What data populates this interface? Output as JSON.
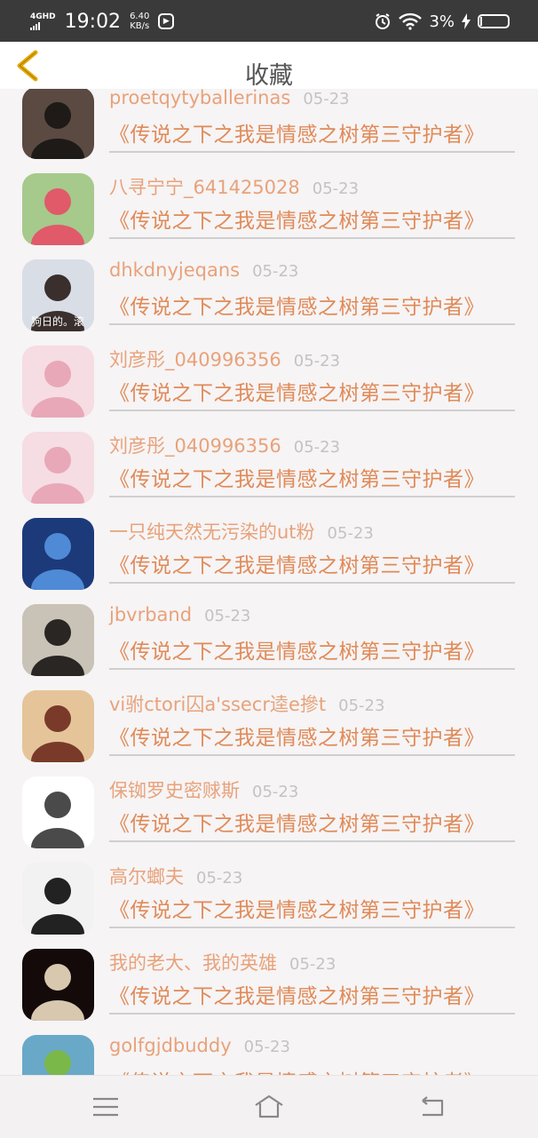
{
  "status": {
    "network": "4GHD",
    "time": "19:02",
    "speed_value": "6.40",
    "speed_unit": "KB/s",
    "battery": "3%"
  },
  "header": {
    "title": "收藏"
  },
  "colors": {
    "accent": "#e08a58",
    "name": "#e8a27a",
    "date": "#c3c3c3",
    "back": "#e6a800"
  },
  "items": [
    {
      "name": "proetqytyballerinas",
      "date": "05-23",
      "book": "《传说之下之我是情感之树第三守护者》",
      "avatar": {
        "bg": "#5a4a42",
        "accent": "#1e1a18",
        "caption": ""
      }
    },
    {
      "name": "八寻宁宁_641425028",
      "date": "05-23",
      "book": "《传说之下之我是情感之树第三守护者》",
      "avatar": {
        "bg": "#a6c98c",
        "accent": "#e05a6a",
        "caption": ""
      }
    },
    {
      "name": "dhkdnyjeqans",
      "date": "05-23",
      "book": "《传说之下之我是情感之树第三守护者》",
      "avatar": {
        "bg": "#d8dde6",
        "accent": "#3a2f2c",
        "caption": "狗日的。滚"
      }
    },
    {
      "name": "刘彦彤_040996356",
      "date": "05-23",
      "book": "《传说之下之我是情感之树第三守护者》",
      "avatar": {
        "bg": "#f6dce3",
        "accent": "#e8a8b8",
        "caption": ""
      }
    },
    {
      "name": "刘彦彤_040996356",
      "date": "05-23",
      "book": "《传说之下之我是情感之树第三守护者》",
      "avatar": {
        "bg": "#f6dce3",
        "accent": "#e8a8b8",
        "caption": ""
      }
    },
    {
      "name": "一只纯天然无污染的ut粉",
      "date": "05-23",
      "book": "《传说之下之我是情感之树第三守护者》",
      "avatar": {
        "bg": "#1c3a7a",
        "accent": "#4f8ad6",
        "caption": ""
      }
    },
    {
      "name": "jbvrband",
      "date": "05-23",
      "book": "《传说之下之我是情感之树第三守护者》",
      "avatar": {
        "bg": "#c9c2b6",
        "accent": "#2a2624",
        "caption": ""
      }
    },
    {
      "name": "vi驸ctori囚a'ssecr逵e摻t",
      "date": "05-23",
      "book": "《传说之下之我是情感之树第三守护者》",
      "avatar": {
        "bg": "#e6c49a",
        "accent": "#7a3a2a",
        "caption": ""
      }
    },
    {
      "name": "保铷罗史密赇斯",
      "date": "05-23",
      "book": "《传说之下之我是情感之树第三守护者》",
      "avatar": {
        "bg": "#ffffff",
        "accent": "#4a4a4a",
        "caption": ""
      }
    },
    {
      "name": "高尔螂夫",
      "date": "05-23",
      "book": "《传说之下之我是情感之树第三守护者》",
      "avatar": {
        "bg": "#f2f2f2",
        "accent": "#222222",
        "caption": ""
      }
    },
    {
      "name": "我的老大、我的英雄",
      "date": "05-23",
      "book": "《传说之下之我是情感之树第三守护者》",
      "avatar": {
        "bg": "#140a0a",
        "accent": "#d8c8b0",
        "caption": ""
      }
    },
    {
      "name": "golfgjdbuddy",
      "date": "05-23",
      "book": "《传说之下之我是情感之树第三守护者》",
      "avatar": {
        "bg": "#6aa8c8",
        "accent": "#7ab84a",
        "caption": ""
      }
    }
  ],
  "navbar": {
    "icons": [
      "menu-icon",
      "home-icon",
      "back-icon"
    ]
  }
}
